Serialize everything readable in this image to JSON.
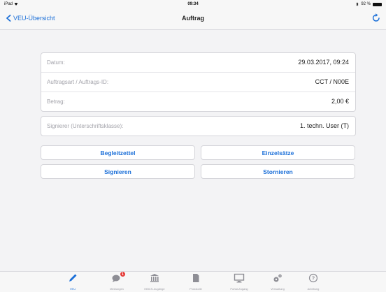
{
  "status": {
    "device": "iPad",
    "time": "09:34",
    "battery": "92 %"
  },
  "nav": {
    "back_label": "VEU-Übersicht",
    "title": "Auftrag"
  },
  "details": {
    "rows": [
      {
        "label": "Datum:",
        "value": "29.03.2017, 09:24"
      },
      {
        "label": "Auftragsart / Auftrags-ID:",
        "value": "CCT / N00E"
      },
      {
        "label": "Betrag:",
        "value": "2,00 €"
      }
    ]
  },
  "signer": {
    "label": "Signierer (Unterschriftsklasse):",
    "value": "1. techn. User (T)"
  },
  "actions": {
    "begleitzettel": "Begleitzettel",
    "einzelsaetze": "Einzelsätze",
    "signieren": "Signieren",
    "stornieren": "Stornieren"
  },
  "tabs": [
    {
      "label": "VEU",
      "icon": "pencil-icon"
    },
    {
      "label": "Meldungen",
      "icon": "messages-icon",
      "badge": "1"
    },
    {
      "label": "EBICS-Zugänge",
      "icon": "bank-icon"
    },
    {
      "label": "Protokolle",
      "icon": "document-icon"
    },
    {
      "label": "Portal-Zugang",
      "icon": "monitor-icon"
    },
    {
      "label": "Verwaltung",
      "icon": "gears-icon"
    },
    {
      "label": "Anleitung",
      "icon": "help-icon"
    }
  ],
  "colors": {
    "accent": "#1b6fd8",
    "badge": "#e53935"
  }
}
